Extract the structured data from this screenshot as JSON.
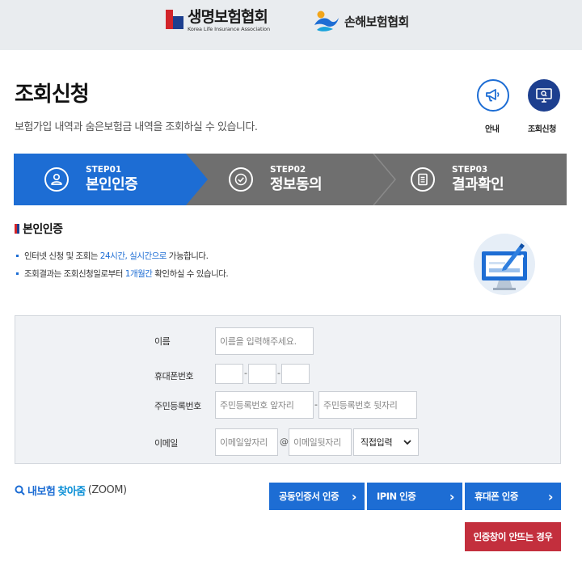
{
  "header": {
    "life_logo_ko": "생명보험협회",
    "life_logo_en": "Korea Life Insurance Association",
    "general_logo_ko": "손해보험협회"
  },
  "page": {
    "title": "조회신청",
    "description": "보험가입 내역과 숨은보험금 내역을 조회하실 수 있습니다."
  },
  "quick_buttons": {
    "info_label": "안내",
    "inquiry_label": "조회신청"
  },
  "steps": [
    {
      "number": "STEP01",
      "name": "본인인증",
      "active": true,
      "icon": "person-icon"
    },
    {
      "number": "STEP02",
      "name": "정보동의",
      "active": false,
      "icon": "check-icon"
    },
    {
      "number": "STEP03",
      "name": "결과확인",
      "active": false,
      "icon": "document-icon"
    }
  ],
  "colors": {
    "active_step": "#1d6dd4",
    "inactive_step": "#6f6f6f",
    "primary_button": "#1d6dd4",
    "danger_button": "#c32f3d",
    "brand_navy": "#1d3f8f",
    "brand_red": "#d2242a"
  },
  "section": {
    "title": "본인인증",
    "notes": [
      {
        "pre": "인터넷 신청 및 조회는 ",
        "highlight": "24시간, 실시간으로",
        "post": " 가능합니다."
      },
      {
        "pre": "조회결과는 조회신청일로부터 ",
        "highlight": "1개월간",
        "post": " 확인하실 수 있습니다."
      }
    ]
  },
  "form": {
    "name_label": "이름",
    "name_placeholder": "이름을 입력해주세요.",
    "phone_label": "휴대폰번호",
    "phone_separator": "-",
    "rrn_label": "주민등록번호",
    "rrn_front_placeholder": "주민등록번호 앞자리",
    "rrn_back_placeholder": "주민등록번호 뒷자리",
    "rrn_separator": "-",
    "email_label": "이메일",
    "email_front_placeholder": "이메일앞자리",
    "email_at": "@",
    "email_back_placeholder": "이메일뒷자리",
    "email_domain_selected": "직접입력"
  },
  "zoom_link": {
    "word1": "내보험",
    "word2": "찾아줌",
    "word3": "(ZOOM)"
  },
  "auth_buttons": {
    "cert": "공동인증서 인증",
    "ipin": "IPIN 인증",
    "phone": "휴대폰 인증",
    "chevron": "›"
  },
  "no_phone_button": "인증창이 안뜨는 경우"
}
